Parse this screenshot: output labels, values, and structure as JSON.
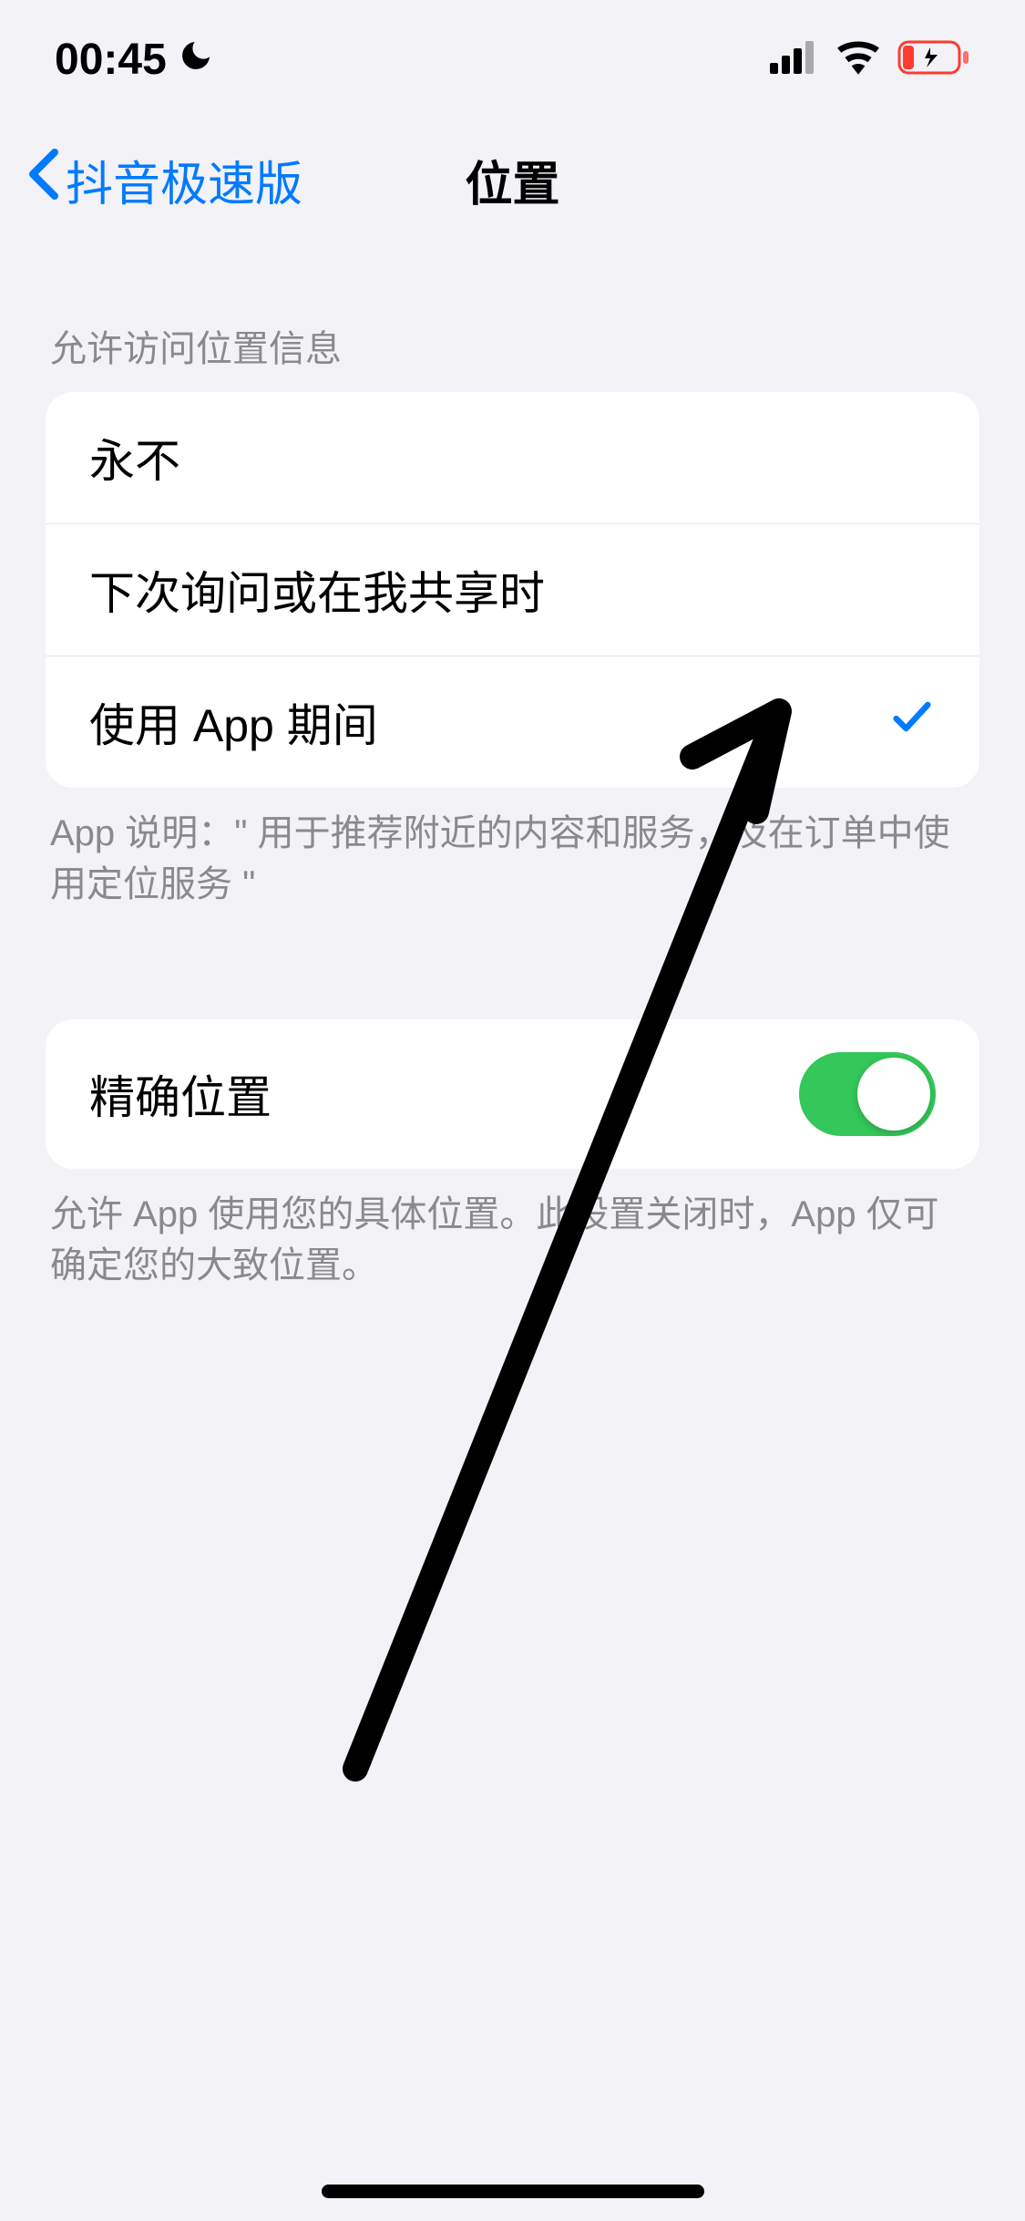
{
  "status": {
    "time": "00:45"
  },
  "nav": {
    "back_label": "抖音极速版",
    "title": "位置"
  },
  "location_section": {
    "header": "允许访问位置信息",
    "options": {
      "never": "永不",
      "ask": "下次询问或在我共享时",
      "while_using": "使用 App 期间"
    },
    "footer": "App 说明：\" 用于推荐附近的内容和服务，及在订单中使用定位服务 \""
  },
  "precise_section": {
    "label": "精确位置",
    "footer": "允许 App 使用您的具体位置。此设置关闭时，App 仅可确定您的大致位置。"
  }
}
